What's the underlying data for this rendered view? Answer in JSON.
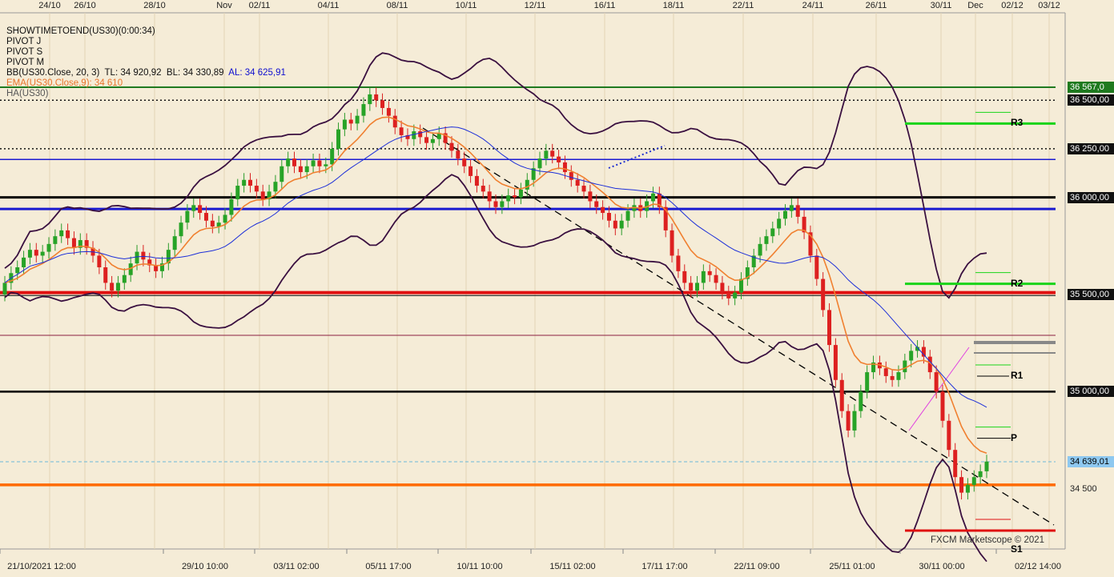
{
  "chart_data": {
    "type": "line",
    "symbol": "US30",
    "indicators": [
      {
        "text": "SHOWTIMETOEND(US30)(0:00:34)",
        "color": "#111111"
      },
      {
        "text": "PIVOT J",
        "color": "#111111"
      },
      {
        "text": "PIVOT S",
        "color": "#111111"
      },
      {
        "text": "PIVOT M",
        "color": "#111111"
      },
      {
        "text_parts": [
          "BB(US30.Close, 20, 3)",
          "TL: 34 920,92",
          "BL: 34 330,89",
          "AL: 34 625,91"
        ],
        "colors": [
          "#111111",
          "#111111",
          "#111111",
          "#1010d0"
        ]
      },
      {
        "text": "EMA(US30.Close,9): 34 610",
        "color": "#e8732a"
      },
      {
        "text": "HA(US30)",
        "color": "#555555"
      }
    ],
    "top_axis_labels": [
      "24/10",
      "26/10",
      "28/10",
      "Nov",
      "02/11",
      "04/11",
      "08/11",
      "10/11",
      "12/11",
      "16/11",
      "18/11",
      "22/11",
      "24/11",
      "26/11",
      "30/11",
      "Dec",
      "02/12",
      "03/12"
    ],
    "bottom_axis_labels": [
      "21/10/2021 12:00",
      "29/10 10:00",
      "03/11 02:00",
      "05/11 17:00",
      "10/11 10:00",
      "15/11 02:00",
      "17/11 17:00",
      "22/11 09:00",
      "25/11 01:00",
      "30/11 00:00",
      "02/12 14:00"
    ],
    "y_axis_tags": [
      {
        "text": "36 567,0",
        "value": 36567,
        "bg": "#1f7a1f",
        "fg": "#ffffff"
      },
      {
        "text": "36 500,00",
        "value": 36500,
        "bg": "#111111",
        "fg": "#ffffff"
      },
      {
        "text": "36 250,00",
        "value": 36250,
        "bg": "#111111",
        "fg": "#ffffff"
      },
      {
        "text": "36 000,00",
        "value": 36000,
        "bg": "#111111",
        "fg": "#ffffff"
      },
      {
        "text": "35 500,00",
        "value": 35500,
        "bg": "#111111",
        "fg": "#ffffff"
      },
      {
        "text": "35 000,00",
        "value": 35000,
        "bg": "#111111",
        "fg": "#ffffff"
      },
      {
        "text": "34 639,01",
        "value": 34639,
        "bg": "#8ec8f0",
        "fg": "#000000"
      },
      {
        "text": "34 500",
        "value": 34500,
        "bg": "transparent",
        "fg": "#222222"
      }
    ],
    "ylim": [
      34190,
      36950
    ],
    "levels": [
      {
        "value": 36567,
        "color": "#1f7a1f",
        "style": "solid",
        "width": 2
      },
      {
        "value": 36500,
        "color": "#111111",
        "style": "dotted",
        "width": 1.5
      },
      {
        "value": 36250,
        "color": "#111111",
        "style": "dotted",
        "width": 1.5
      },
      {
        "value": 36195,
        "color": "#1a1ad0",
        "style": "solid",
        "width": 1.5
      },
      {
        "value": 36000,
        "color": "#000000",
        "style": "solid",
        "width": 3
      },
      {
        "value": 35940,
        "color": "#1a1ad0",
        "style": "solid",
        "width": 3
      },
      {
        "value": 35510,
        "color": "#e01010",
        "style": "solid",
        "width": 4
      },
      {
        "value": 35495,
        "color": "#000000",
        "style": "solid",
        "width": 1
      },
      {
        "value": 35290,
        "color": "#8a2040",
        "style": "solid",
        "width": 1
      },
      {
        "value": 35000,
        "color": "#000000",
        "style": "solid",
        "width": 2.5
      },
      {
        "value": 34639,
        "color": "#6ab8d8",
        "style": "dashed",
        "width": 1
      },
      {
        "value": 34520,
        "color": "#ff6a00",
        "style": "solid",
        "width": 3.5
      }
    ],
    "pivots": [
      {
        "label": "R3",
        "value": 36380,
        "color": "#19d419"
      },
      {
        "label": "R2",
        "value": 35555,
        "color": "#19d419"
      },
      {
        "label": "R1",
        "value": 35080,
        "color": "#000000"
      },
      {
        "label": "P",
        "value": 34760,
        "color": "#000000"
      },
      {
        "label": "S1",
        "value": 34285,
        "color": "#e01010"
      }
    ],
    "watermark": "FXCM Marketscope © 2021",
    "candles": [
      [
        35500,
        35560
      ],
      [
        35560,
        35610
      ],
      [
        35610,
        35640
      ],
      [
        35640,
        35690
      ],
      [
        35690,
        35730
      ],
      [
        35730,
        35700
      ],
      [
        35700,
        35720
      ],
      [
        35720,
        35760
      ],
      [
        35760,
        35800
      ],
      [
        35800,
        35830
      ],
      [
        35830,
        35790
      ],
      [
        35790,
        35740
      ],
      [
        35740,
        35780
      ],
      [
        35780,
        35740
      ],
      [
        35740,
        35700
      ],
      [
        35700,
        35640
      ],
      [
        35640,
        35560
      ],
      [
        35560,
        35520
      ],
      [
        35520,
        35560
      ],
      [
        35560,
        35600
      ],
      [
        35600,
        35660
      ],
      [
        35660,
        35720
      ],
      [
        35720,
        35680
      ],
      [
        35680,
        35650
      ],
      [
        35650,
        35620
      ],
      [
        35620,
        35660
      ],
      [
        35660,
        35730
      ],
      [
        35730,
        35800
      ],
      [
        35800,
        35870
      ],
      [
        35870,
        35930
      ],
      [
        35930,
        35960
      ],
      [
        35960,
        35920
      ],
      [
        35920,
        35880
      ],
      [
        35880,
        35850
      ],
      [
        35850,
        35870
      ],
      [
        35870,
        35910
      ],
      [
        35910,
        35990
      ],
      [
        35990,
        36060
      ],
      [
        36060,
        36090
      ],
      [
        36090,
        36060
      ],
      [
        36060,
        36030
      ],
      [
        36030,
        35990
      ],
      [
        35990,
        36030
      ],
      [
        36030,
        36080
      ],
      [
        36080,
        36160
      ],
      [
        36160,
        36200
      ],
      [
        36200,
        36160
      ],
      [
        36160,
        36130
      ],
      [
        36130,
        36160
      ],
      [
        36160,
        36190
      ],
      [
        36190,
        36160
      ],
      [
        36160,
        36170
      ],
      [
        36170,
        36250
      ],
      [
        36250,
        36350
      ],
      [
        36350,
        36400
      ],
      [
        36400,
        36380
      ],
      [
        36380,
        36420
      ],
      [
        36420,
        36480
      ],
      [
        36480,
        36530
      ],
      [
        36530,
        36500
      ],
      [
        36500,
        36460
      ],
      [
        36460,
        36420
      ],
      [
        36420,
        36360
      ],
      [
        36360,
        36320
      ],
      [
        36320,
        36300
      ],
      [
        36300,
        36340
      ],
      [
        36340,
        36310
      ],
      [
        36310,
        36280
      ],
      [
        36280,
        36300
      ],
      [
        36300,
        36330
      ],
      [
        36330,
        36280
      ],
      [
        36280,
        36240
      ],
      [
        36240,
        36200
      ],
      [
        36200,
        36160
      ],
      [
        36160,
        36110
      ],
      [
        36110,
        36060
      ],
      [
        36060,
        36030
      ],
      [
        36030,
        35980
      ],
      [
        35980,
        35950
      ],
      [
        35950,
        35980
      ],
      [
        35980,
        36010
      ],
      [
        36010,
        36000
      ],
      [
        36000,
        36040
      ],
      [
        36040,
        36090
      ],
      [
        36090,
        36150
      ],
      [
        36150,
        36200
      ],
      [
        36200,
        36240
      ],
      [
        36240,
        36210
      ],
      [
        36210,
        36180
      ],
      [
        36180,
        36130
      ],
      [
        36130,
        36090
      ],
      [
        36090,
        36060
      ],
      [
        36060,
        36030
      ],
      [
        36030,
        35980
      ],
      [
        35980,
        35950
      ],
      [
        35950,
        35920
      ],
      [
        35920,
        35880
      ],
      [
        35880,
        35840
      ],
      [
        35840,
        35880
      ],
      [
        35880,
        35930
      ],
      [
        35930,
        35960
      ],
      [
        35960,
        35930
      ],
      [
        35930,
        35980
      ],
      [
        35980,
        36020
      ],
      [
        36020,
        35950
      ],
      [
        35950,
        35830
      ],
      [
        35830,
        35700
      ],
      [
        35700,
        35620
      ],
      [
        35620,
        35560
      ],
      [
        35560,
        35520
      ],
      [
        35520,
        35560
      ],
      [
        35560,
        35620
      ],
      [
        35620,
        35600
      ],
      [
        35600,
        35560
      ],
      [
        35560,
        35510
      ],
      [
        35510,
        35480
      ],
      [
        35480,
        35510
      ],
      [
        35510,
        35580
      ],
      [
        35580,
        35640
      ],
      [
        35640,
        35700
      ],
      [
        35700,
        35760
      ],
      [
        35760,
        35800
      ],
      [
        35800,
        35840
      ],
      [
        35840,
        35890
      ],
      [
        35890,
        35930
      ],
      [
        35930,
        35960
      ],
      [
        35960,
        35900
      ],
      [
        35900,
        35820
      ],
      [
        35820,
        35700
      ],
      [
        35700,
        35580
      ],
      [
        35580,
        35420
      ],
      [
        35420,
        35240
      ],
      [
        35240,
        35060
      ],
      [
        35060,
        34900
      ],
      [
        34900,
        34800
      ],
      [
        34800,
        34900
      ],
      [
        34900,
        35000
      ],
      [
        35000,
        35100
      ],
      [
        35100,
        35150
      ],
      [
        35150,
        35120
      ],
      [
        35120,
        35080
      ],
      [
        35080,
        35060
      ],
      [
        35060,
        35100
      ],
      [
        35100,
        35160
      ],
      [
        35160,
        35210
      ],
      [
        35210,
        35230
      ],
      [
        35230,
        35180
      ],
      [
        35180,
        35100
      ],
      [
        35100,
        35000
      ],
      [
        35000,
        34850
      ],
      [
        34850,
        34700
      ],
      [
        34700,
        34560
      ],
      [
        34560,
        34480
      ],
      [
        34480,
        34520
      ],
      [
        34520,
        34560
      ],
      [
        34560,
        34590
      ],
      [
        34590,
        34640
      ]
    ]
  }
}
